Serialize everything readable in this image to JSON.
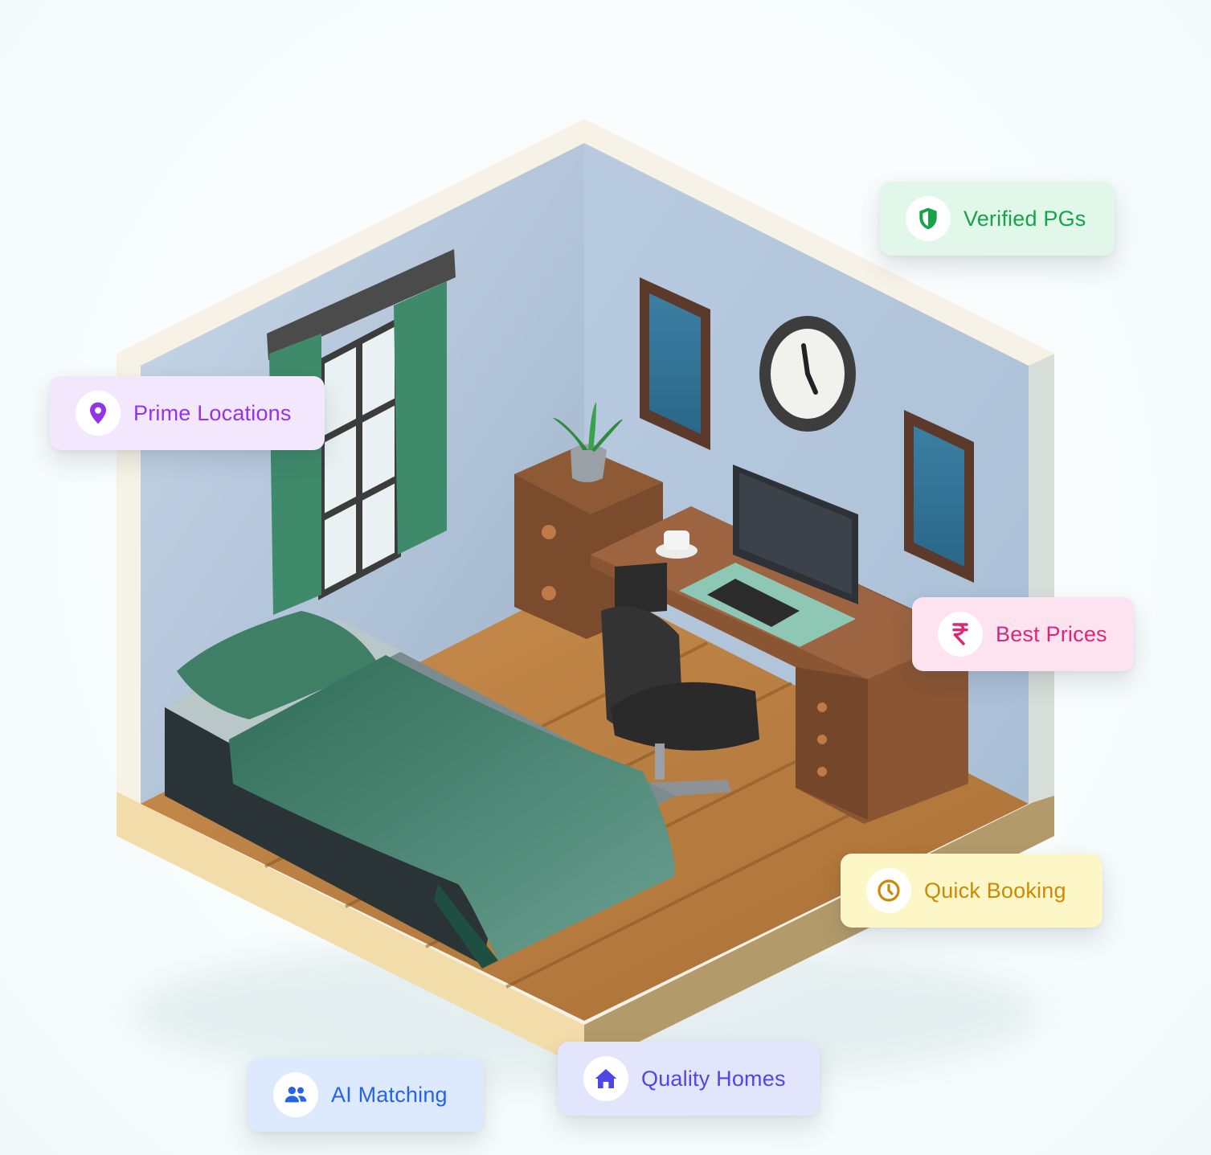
{
  "illustration": {
    "name": "isometric-bedroom"
  },
  "badges": {
    "verified": {
      "label": "Verified PGs",
      "icon": "shield-icon",
      "color": "#16a34a"
    },
    "prime": {
      "label": "Prime Locations",
      "icon": "map-pin-icon",
      "color": "#9333ea"
    },
    "prices": {
      "label": "Best Prices",
      "icon": "rupee-icon",
      "color": "#db2777"
    },
    "booking": {
      "label": "Quick Booking",
      "icon": "clock-icon",
      "color": "#ca8a04"
    },
    "quality": {
      "label": "Quality Homes",
      "icon": "home-icon",
      "color": "#4f46e5"
    },
    "ai": {
      "label": "AI Matching",
      "icon": "users-icon",
      "color": "#2563eb"
    }
  }
}
